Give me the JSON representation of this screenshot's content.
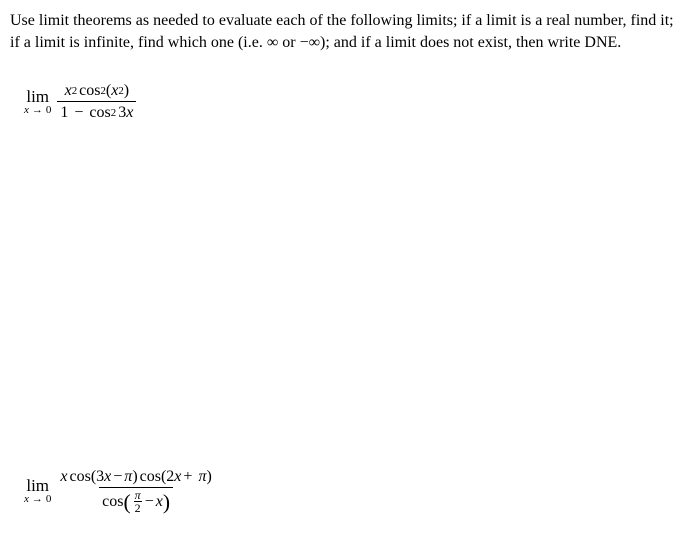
{
  "instructions": "Use limit theorems as needed to evaluate each of the following limits; if a limit is a real number, find it; if a limit is infinite, find which one (i.e. ∞ or −∞); and if a limit does not exist, then write DNE.",
  "lim": {
    "label": "lim",
    "var": "x",
    "arrow": "→",
    "to": "0"
  },
  "symbols": {
    "cos": "cos",
    "x": "x",
    "pi": "π",
    "minus": "−",
    "plus": "+",
    "one": "1",
    "two": "2",
    "three": "3",
    "lp": "(",
    "rp": ")"
  }
}
